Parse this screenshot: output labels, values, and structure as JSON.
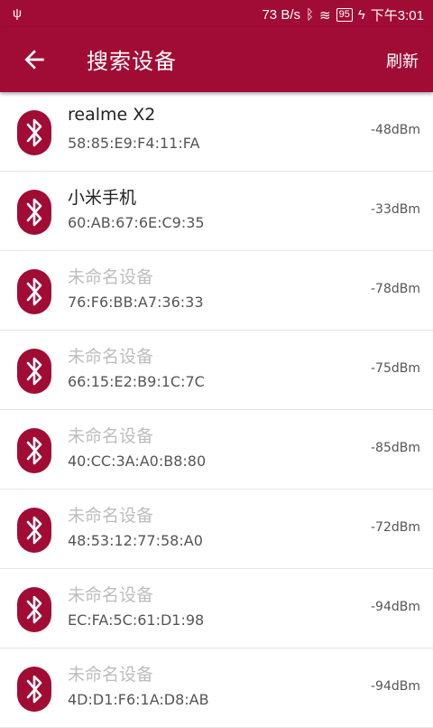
{
  "status": {
    "speed": "73 B/s",
    "battery": "95",
    "time": "下午3:01"
  },
  "appbar": {
    "title": "搜索设备",
    "refresh": "刷新"
  },
  "colors": {
    "primary": "#a10c35"
  },
  "devices": [
    {
      "name": "realme X2",
      "mac": "58:85:E9:F4:11:FA",
      "rssi": "-48dBm",
      "named": true
    },
    {
      "name": "小米手机",
      "mac": "60:AB:67:6E:C9:35",
      "rssi": "-33dBm",
      "named": true
    },
    {
      "name": "未命名设备",
      "mac": "76:F6:BB:A7:36:33",
      "rssi": "-78dBm",
      "named": false
    },
    {
      "name": "未命名设备",
      "mac": "66:15:E2:B9:1C:7C",
      "rssi": "-75dBm",
      "named": false
    },
    {
      "name": "未命名设备",
      "mac": "40:CC:3A:A0:B8:80",
      "rssi": "-85dBm",
      "named": false
    },
    {
      "name": "未命名设备",
      "mac": "48:53:12:77:58:A0",
      "rssi": "-72dBm",
      "named": false
    },
    {
      "name": "未命名设备",
      "mac": "EC:FA:5C:61:D1:98",
      "rssi": "-94dBm",
      "named": false
    },
    {
      "name": "未命名设备",
      "mac": "4D:D1:F6:1A:D8:AB",
      "rssi": "-94dBm",
      "named": false
    }
  ]
}
